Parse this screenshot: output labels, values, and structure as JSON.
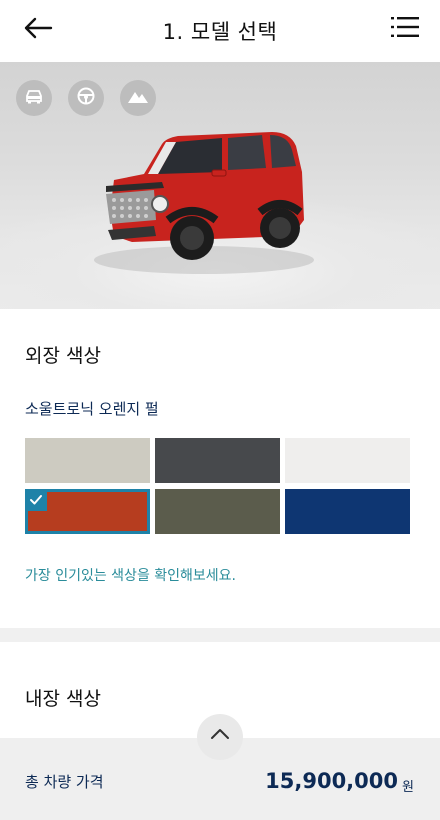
{
  "header": {
    "title": "1. 모델 선택",
    "back_icon": "arrow-left-icon",
    "menu_icon": "menu-list-icon"
  },
  "viewer": {
    "buttons": [
      {
        "icon": "exterior-view-icon"
      },
      {
        "icon": "interior-view-icon"
      },
      {
        "icon": "background-mountain-icon"
      }
    ]
  },
  "exterior": {
    "title": "외장 색상",
    "selected_color_name": "소울트로닉 오렌지 펄",
    "swatches": [
      {
        "color": "#cdcbc1",
        "selected": false
      },
      {
        "color": "#47494c",
        "selected": false
      },
      {
        "color": "#efeeed",
        "selected": false
      },
      {
        "color": "#b63d1f",
        "selected": true
      },
      {
        "color": "#5b5c4c",
        "selected": false
      },
      {
        "color": "#0e3672",
        "selected": false
      }
    ],
    "hint_link": "가장 인기있는 색상을 확인해보세요."
  },
  "interior": {
    "title": "내장 색상"
  },
  "footer": {
    "total_label": "총 차량 가격",
    "price": "15,900,000",
    "currency": "원"
  },
  "colors": {
    "accent": "#1e82a8",
    "navy": "#0d2a55",
    "hint": "#2a8c9a"
  }
}
